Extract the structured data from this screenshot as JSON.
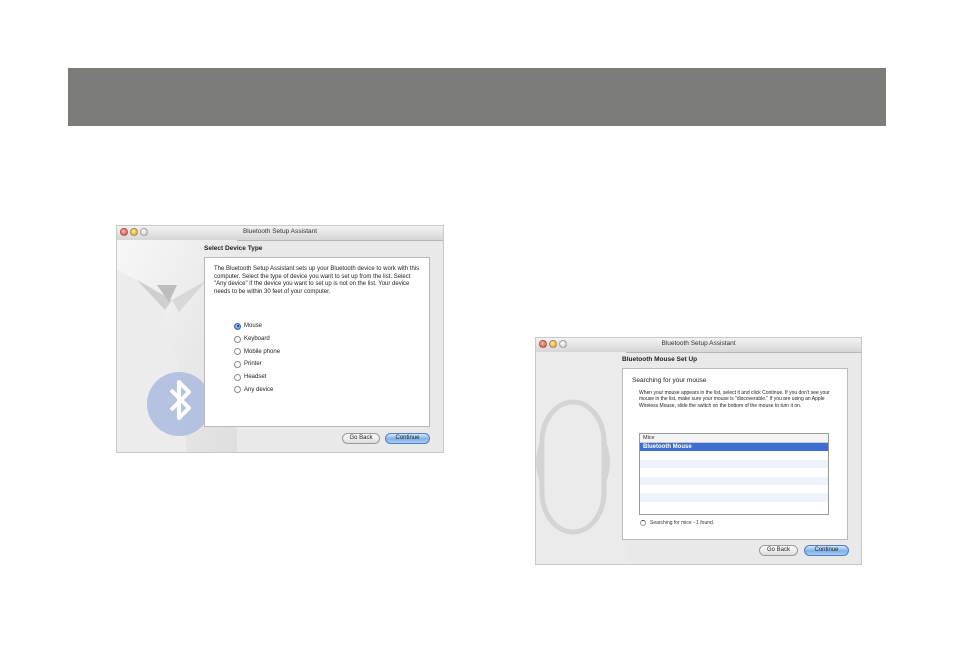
{
  "window1": {
    "title": "Bluetooth Setup Assistant",
    "heading": "Select Device Type",
    "description": "The Bluetooth Setup Assistant sets up your Bluetooth device to work with this computer. Select the type of device you want to set up from the list. Select \"Any device\" if the device you want to set up is not on the list. Your device needs to be within 30 feet of your computer.",
    "options": [
      "Mouse",
      "Keyboard",
      "Mobile phone",
      "Printer",
      "Headset",
      "Any device"
    ],
    "selected_option": "Mouse",
    "back_label": "Go Back",
    "continue_label": "Continue"
  },
  "window2": {
    "title": "Bluetooth Setup Assistant",
    "heading": "Bluetooth Mouse Set Up",
    "subheading": "Searching for your mouse",
    "description": "When your mouse appears in the list, select it and click Continue. If you don't see your mouse in the list, make sure your mouse is \"discoverable.\" If you are using an Apple Wireless Mouse, slide the switch on the bottom of the mouse to turn it on.",
    "list_header": "Mice",
    "list_items": [
      "Bluetooth Mouse"
    ],
    "status": "Searching for mice - 1 found.",
    "back_label": "Go Back",
    "continue_label": "Continue"
  },
  "colors": {
    "band": "#7c7d78",
    "selection": "#3f6ed1",
    "primary_button": "#7fb0ea"
  },
  "icons": [
    "close-icon",
    "minimize-icon",
    "zoom-icon",
    "bluetooth-icon",
    "tuxedo-illustration",
    "mouse-illustration",
    "spinner-icon"
  ]
}
